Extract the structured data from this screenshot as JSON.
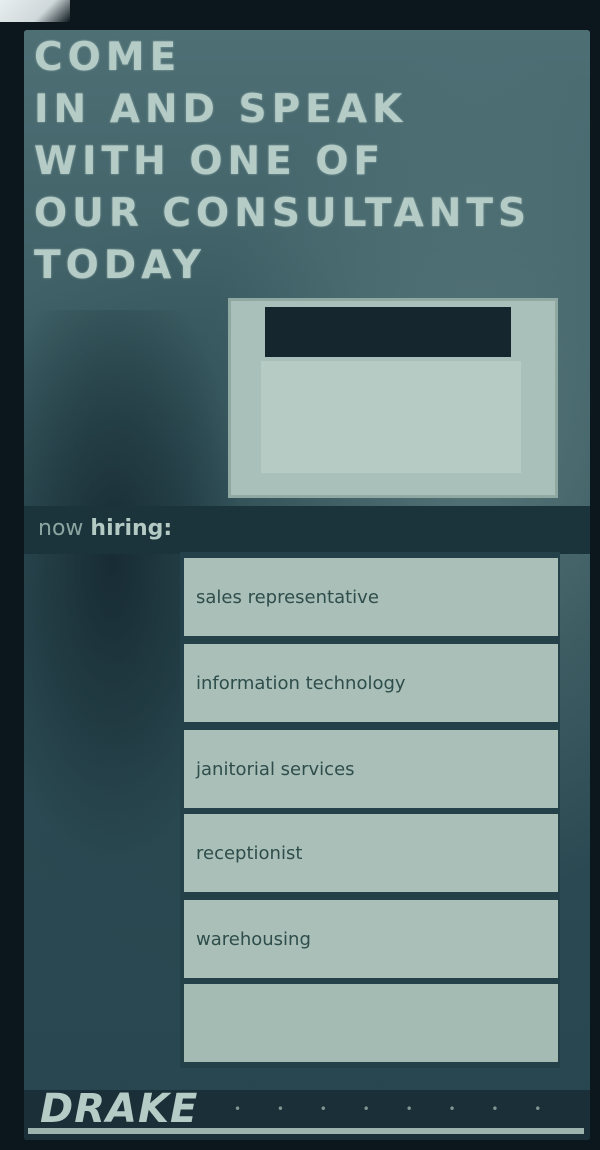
{
  "headline": {
    "lines": [
      "COME",
      "IN AND SPEAK",
      "WITH ONE OF",
      "OUR CONSULTANTS",
      "TODAY"
    ]
  },
  "hiring": {
    "prefix": "now",
    "label": "hiring:"
  },
  "jobs": [
    "sales representative",
    "information technology",
    "janitorial services",
    "receptionist",
    "warehousing",
    ""
  ],
  "brand": {
    "name": "DRAKE",
    "dots": "• • • • • • • •"
  }
}
